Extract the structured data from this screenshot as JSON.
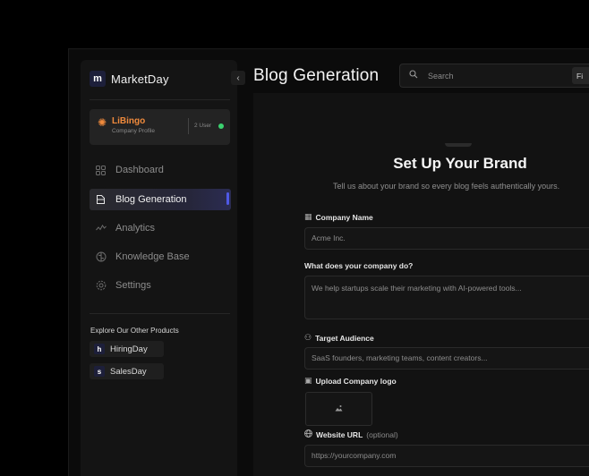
{
  "brand": {
    "logo_letter": "m",
    "name": "MarketDay"
  },
  "company": {
    "name": "LiBingo",
    "subtitle": "Company Profile",
    "users": "2 User",
    "status_color": "#3bd16f"
  },
  "nav": [
    {
      "label": "Dashboard",
      "icon": "grid-icon"
    },
    {
      "label": "Blog Generation",
      "icon": "document-icon",
      "active": true
    },
    {
      "label": "Analytics",
      "icon": "analytics-icon"
    },
    {
      "label": "Knowledge Base",
      "icon": "brain-icon"
    },
    {
      "label": "Settings",
      "icon": "gear-icon"
    }
  ],
  "explore": {
    "title": "Explore Our Other Products",
    "products": [
      {
        "letter": "h",
        "label": "HiringDay"
      },
      {
        "letter": "s",
        "label": "SalesDay"
      }
    ]
  },
  "header": {
    "title": "Blog Generation",
    "search_placeholder": "Search",
    "filter_label": "Fi"
  },
  "form": {
    "title": "Set Up Your Brand",
    "subtitle": "Tell us about your brand so every blog feels authentically yours.",
    "company_name": {
      "label": "Company Name",
      "placeholder": "Acme Inc."
    },
    "description": {
      "label": "What does your company do?",
      "placeholder": "We help startups scale their marketing with AI-powered tools..."
    },
    "audience": {
      "label": "Target Audience",
      "placeholder": "SaaS founders, marketing teams, content creators..."
    },
    "logo": {
      "label": "Upload Company logo"
    },
    "website": {
      "label": "Website URL",
      "optional": "(optional)",
      "placeholder": "https://yourcompany.com"
    }
  },
  "colors": {
    "accent": "#4f59e6",
    "brand_orange": "#f08a3c"
  }
}
